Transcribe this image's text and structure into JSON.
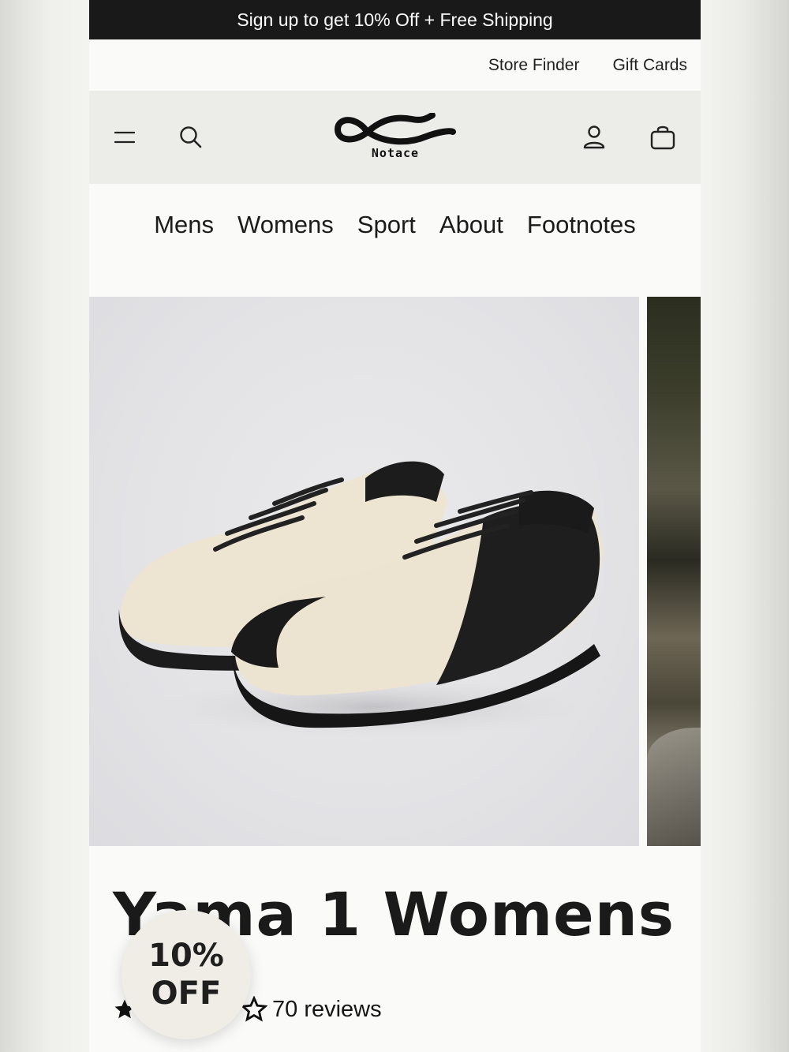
{
  "promo": {
    "text": "Sign up to get 10% Off + Free Shipping"
  },
  "utility_nav": {
    "store_finder": "Store Finder",
    "gift_cards": "Gift Cards"
  },
  "header": {
    "brand": "Notace"
  },
  "main_nav": [
    "Mens",
    "Womens",
    "Sport",
    "About",
    "Footnotes"
  ],
  "product": {
    "title": "Yama 1 Womens",
    "reviews": "70 reviews",
    "image_alt": "Yama 1 Womens shoes, cream and black"
  },
  "badge": {
    "line1": "10%",
    "line2": "OFF"
  },
  "colors": {
    "promo_bg": "#191919",
    "header_bg": "#ecede8",
    "badge_bg": "#f0ece6"
  },
  "icons": [
    "menu-icon",
    "search-icon",
    "account-icon",
    "cart-icon",
    "star-icon"
  ]
}
